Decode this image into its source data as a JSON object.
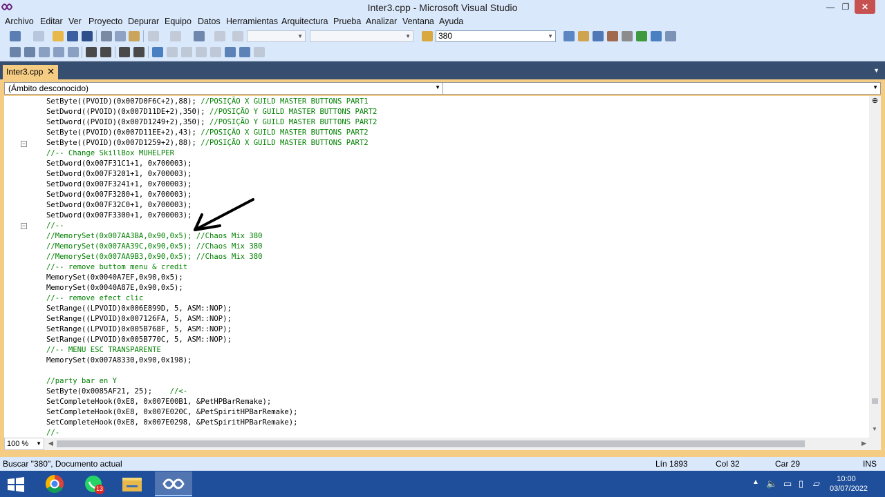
{
  "window": {
    "title": "Inter3.cpp - Microsoft Visual Studio",
    "min_glyph": "—",
    "max_glyph": "❐",
    "close_glyph": "✕"
  },
  "menu": {
    "items": [
      "Archivo",
      "Editar",
      "Ver",
      "Proyecto",
      "Depurar",
      "Equipo",
      "Datos",
      "Herramientas",
      "Arquitectura",
      "Prueba",
      "Analizar",
      "Ventana",
      "Ayuda"
    ]
  },
  "toolbar": {
    "find_combo_value": "380"
  },
  "tabs": {
    "active_label": "Inter3.cpp",
    "close_glyph": "✕",
    "dropdown_glyph": "▼"
  },
  "navigation": {
    "scope_label": "(Ámbito desconocido)",
    "member_label": ""
  },
  "editor": {
    "lines": [
      {
        "code": "SetByte((PVOID)(0x007D0F6C+2),88); ",
        "comment": "//POSIÇÃO X GUILD MASTER BUTTONS PART1"
      },
      {
        "code": "SetDword((PVOID)(0x007D11DE+2),350); ",
        "comment": "//POSIÇÃO Y GUILD MASTER BUTTONS PART2"
      },
      {
        "code": "SetDword((PVOID)(0x007D1249+2),350); ",
        "comment": "//POSIÇÃO Y GUILD MASTER BUTTONS PART2"
      },
      {
        "code": "SetByte((PVOID)(0x007D11EE+2),43); ",
        "comment": "//POSIÇÃO X GUILD MASTER BUTTONS PART2"
      },
      {
        "code": "SetByte((PVOID)(0x007D1259+2),88); ",
        "comment": "//POSIÇÃO X GUILD MASTER BUTTONS PART2"
      },
      {
        "code": "",
        "comment": "//-- Change SkillBox MUHELPER"
      },
      {
        "code": "SetDword(0x007F31C1+1, 0x700003);",
        "comment": ""
      },
      {
        "code": "SetDword(0x007F3201+1, 0x700003);",
        "comment": ""
      },
      {
        "code": "SetDword(0x007F3241+1, 0x700003);",
        "comment": ""
      },
      {
        "code": "SetDword(0x007F3280+1, 0x700003);",
        "comment": ""
      },
      {
        "code": "SetDword(0x007F32C0+1, 0x700003);",
        "comment": ""
      },
      {
        "code": "SetDword(0x007F3300+1, 0x700003);",
        "comment": ""
      },
      {
        "code": "",
        "comment": "//--"
      },
      {
        "code": "",
        "comment": "//MemorySet(0x007AA3BA,0x90,0x5); //Chaos Mix 380"
      },
      {
        "code": "",
        "comment": "//MemorySet(0x007AA39C,0x90,0x5); //Chaos Mix 380"
      },
      {
        "code": "",
        "comment": "//MemorySet(0x007AA9B3,0x90,0x5); //Chaos Mix 380"
      },
      {
        "code": "",
        "comment": "//-- remove buttom menu & credit"
      },
      {
        "code": "MemorySet(0x0040A7EF,0x90,0x5);",
        "comment": ""
      },
      {
        "code": "MemorySet(0x0040A87E,0x90,0x5);",
        "comment": ""
      },
      {
        "code": "",
        "comment": "//-- remove efect clic"
      },
      {
        "code": "SetRange((LPVOID)0x006E899D, 5, ASM::NOP);",
        "comment": ""
      },
      {
        "code": "SetRange((LPVOID)0x007126FA, 5, ASM::NOP);",
        "comment": ""
      },
      {
        "code": "SetRange((LPVOID)0x005B768F, 5, ASM::NOP);",
        "comment": ""
      },
      {
        "code": "SetRange((LPVOID)0x005B770C, 5, ASM::NOP);",
        "comment": ""
      },
      {
        "code": "",
        "comment": "//-- MENU ESC TRANSPARENTE"
      },
      {
        "code": "MemorySet(0x007A8330,0x90,0x198);",
        "comment": ""
      },
      {
        "code": "",
        "comment": ""
      },
      {
        "code": "",
        "comment": "//party bar en Y"
      },
      {
        "code": "SetByte(0x0085AF21, 25);    ",
        "comment": "//<-"
      },
      {
        "code": "SetCompleteHook(0xE8, 0x007E00B1, &PetHPBarRemake);",
        "comment": ""
      },
      {
        "code": "SetCompleteHook(0xE8, 0x007E020C, &PetSpiritHPBarRemake);",
        "comment": ""
      },
      {
        "code": "SetCompleteHook(0xE8, 0x007E0298, &PetSpiritHPBarRemake);",
        "comment": ""
      },
      {
        "code": "",
        "comment": "//-"
      }
    ],
    "zoom": "100 %"
  },
  "status": {
    "message": "Buscar \"380\", Documento actual",
    "line": "Lín 1893",
    "col": "Col 32",
    "char": "Car 29",
    "mode": "INS"
  },
  "taskbar": {
    "whatsapp_badge": "13",
    "clock_time": "10:00",
    "clock_date": "03/07/2022"
  },
  "colors": {
    "chrome": "#dae8fb",
    "tab_active": "#f5cc84",
    "tab_strip": "#364e6f",
    "comment": "#008000",
    "taskbar": "#1f4f9a"
  }
}
